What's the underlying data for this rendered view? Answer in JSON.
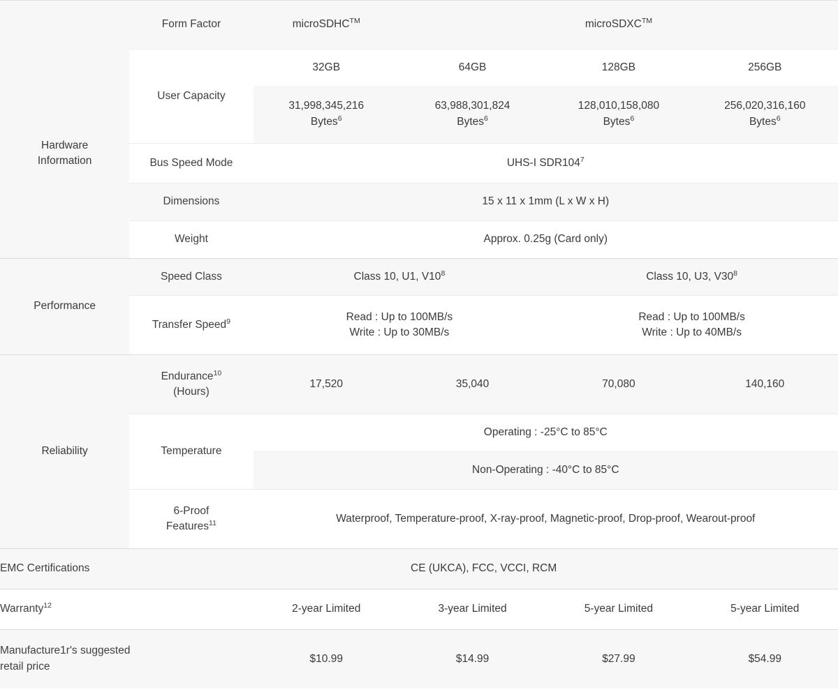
{
  "table": {
    "sections": {
      "hardware": "Hardware\nInformation",
      "performance": "Performance",
      "reliability": "Reliability"
    },
    "rows": {
      "form_factor": {
        "label": "Form Factor",
        "sdhc": "microSDHC",
        "sdhc_sup": "TM",
        "sdxc": "microSDXC",
        "sdxc_sup": "TM"
      },
      "user_capacity": {
        "label": "User Capacity",
        "capacities": [
          "32GB",
          "64GB",
          "128GB",
          "256GB"
        ],
        "bytes": [
          "31,998,345,216\nBytes",
          "63,988,301,824\nBytes",
          "128,010,158,080\nBytes",
          "256,020,316,160\nBytes"
        ],
        "bytes_sup": "6"
      },
      "bus_speed": {
        "label": "Bus Speed Mode",
        "value": "UHS-I SDR104",
        "value_sup": "7"
      },
      "dimensions": {
        "label": "Dimensions",
        "value": "15 x 11 x 1mm (L x W x H)"
      },
      "weight": {
        "label": "Weight",
        "value": "Approx. 0.25g (Card only)"
      },
      "speed_class": {
        "label": "Speed Class",
        "sdhc": "Class 10, U1, V10",
        "sdhc_sup": "8",
        "sdxc": "Class 10, U3, V30",
        "sdxc_sup": "8"
      },
      "transfer_speed": {
        "label": "Transfer Speed",
        "label_sup": "9",
        "sdhc": "Read : Up to 100MB/s\nWrite : Up to 30MB/s",
        "sdxc": "Read : Up to 100MB/s\nWrite : Up to 40MB/s"
      },
      "endurance": {
        "label": "Endurance",
        "label_sup": "10",
        "label_line2": "(Hours)",
        "values": [
          "17,520",
          "35,040",
          "70,080",
          "140,160"
        ]
      },
      "temperature": {
        "label": "Temperature",
        "operating": "Operating : -25°C to 85°C",
        "non_operating": "Non-Operating : -40°C to 85°C"
      },
      "six_proof": {
        "label": "6-Proof",
        "label_line2": "Features",
        "label_sup": "11",
        "value": "Waterproof, Temperature-proof, X-ray-proof, Magnetic-proof, Drop-proof, Wearout-proof"
      },
      "emc": {
        "label": "EMC Certifications",
        "value": "CE (UKCA), FCC, VCCI, RCM"
      },
      "warranty": {
        "label": "Warranty",
        "label_sup": "12",
        "values": [
          "2-year Limited",
          "3-year Limited",
          "5-year Limited",
          "5-year Limited"
        ]
      },
      "msrp": {
        "label": "Manufacture1r's suggested\nretail price",
        "values": [
          "$10.99",
          "$14.99",
          "$27.99",
          "$54.99"
        ]
      }
    }
  },
  "colors": {
    "shade": "#f7f7f7",
    "white": "#ffffff",
    "text": "#3a3a3a",
    "rule": "#e2e2e2"
  }
}
